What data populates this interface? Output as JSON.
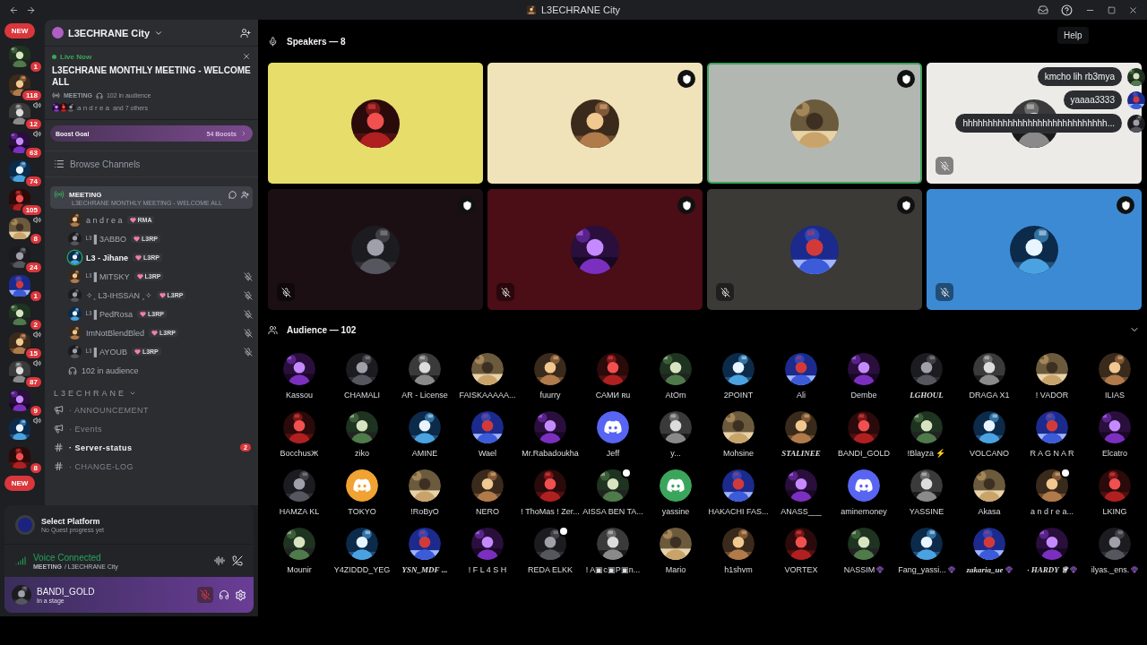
{
  "title_bar": {
    "title": "L3ECHRANE City",
    "tooltip": "Help"
  },
  "servers": [
    {
      "kind": "pill",
      "badge": "NEW"
    },
    {
      "kind": "server",
      "badge": "1",
      "in_voice": false
    },
    {
      "kind": "server",
      "badge": "118",
      "in_voice": false
    },
    {
      "kind": "server",
      "badge": "12",
      "in_voice": true
    },
    {
      "kind": "server",
      "badge": "63",
      "in_voice": true
    },
    {
      "kind": "server",
      "badge": "74",
      "in_voice": false
    },
    {
      "kind": "server",
      "badge": "105",
      "in_voice": false
    },
    {
      "kind": "server",
      "badge": "8",
      "in_voice": true
    },
    {
      "kind": "server",
      "badge": "24",
      "in_voice": false
    },
    {
      "kind": "server",
      "badge": "1",
      "in_voice": false
    },
    {
      "kind": "server",
      "badge": "2",
      "in_voice": false
    },
    {
      "kind": "server",
      "badge": "15",
      "in_voice": true
    },
    {
      "kind": "server",
      "badge": "87",
      "in_voice": true
    },
    {
      "kind": "server",
      "badge": "9",
      "in_voice": false
    },
    {
      "kind": "server",
      "in_voice": true
    },
    {
      "kind": "server",
      "badge": "8",
      "in_voice": false
    },
    {
      "kind": "pill",
      "badge": "NEW"
    }
  ],
  "server": {
    "name": "L3ECHRANE City"
  },
  "event": {
    "status": "Live Now",
    "title": "L3ECHRANE MONTHLY MEETING - WELCOME ALL",
    "channel": "MEETING",
    "audience": "102 in audience",
    "host": "a n d r e a",
    "others": "and 7 others"
  },
  "boost": {
    "label": "Boost Goal",
    "count": "54 Boosts"
  },
  "browse": "Browse Channels",
  "stage_channel": {
    "name": "MEETING",
    "topic": "L3ECHRANE MONTHLY MEETING - WELCOME ALL",
    "selected": true
  },
  "members": [
    {
      "name": "a n d r e a",
      "tag": "RMA",
      "muted": false,
      "speaking": false
    },
    {
      "name": "ᴸ³ ▌3ABBO",
      "tag": "L3RP",
      "muted": false,
      "speaking": false
    },
    {
      "name": "L3 - Jihane",
      "tag": "L3RP",
      "muted": false,
      "speaking": true
    },
    {
      "name": "ᴸ³ ▌MITSKY",
      "tag": "L3RP",
      "muted": true,
      "speaking": false
    },
    {
      "name": "✧˳ L3-IHSSAN ˳✧",
      "tag": "L3RP",
      "muted": true,
      "speaking": false
    },
    {
      "name": "ᴸ³ ▌PedRosa",
      "tag": "L3RP",
      "muted": true,
      "speaking": false
    },
    {
      "name": "ImNotBlendBled",
      "tag": "L3RP",
      "muted": true,
      "speaking": false
    },
    {
      "name": "ᴸ³ ▌AYOUB",
      "tag": "L3RP",
      "muted": true,
      "speaking": false
    }
  ],
  "audience_count": "102 in audience",
  "category": {
    "name": "L3ECHRANE",
    "expanded": true
  },
  "channels": [
    {
      "name": "· ANNOUNCEMENT",
      "kind": "announcement",
      "unread": false
    },
    {
      "name": "· Events",
      "kind": "announcement",
      "unread": false
    },
    {
      "name": "· Server-status",
      "kind": "text",
      "unread": true,
      "mentions": "2"
    },
    {
      "name": "· CHANGE-LOG",
      "kind": "text",
      "unread": false
    }
  ],
  "quest": {
    "title": "Select Platform",
    "subtitle": "No Quest progress yet"
  },
  "voice": {
    "status": "Voice Connected",
    "channel": "MEETING",
    "server": "/ L3ECHRANE City"
  },
  "user": {
    "name": "BANDI_GOLD",
    "status": "In a stage",
    "mic_muted": true
  },
  "speakers_header": "Speakers — 8",
  "speakers": [
    {
      "color": "#e6dd6a",
      "moderator": false,
      "muted": false,
      "speaking": false
    },
    {
      "color": "#f0e3b9",
      "moderator": true,
      "muted": false,
      "speaking": false
    },
    {
      "color": "#b3b7b1",
      "moderator": true,
      "muted": false,
      "speaking": true
    },
    {
      "color": "#edebe8",
      "moderator": false,
      "muted": true,
      "speaking": false
    },
    {
      "color": "#1c0f14",
      "moderator": true,
      "muted": true,
      "speaking": false
    },
    {
      "color": "#4b0d16",
      "moderator": true,
      "muted": true,
      "speaking": false
    },
    {
      "color": "#3b3a37",
      "moderator": true,
      "muted": true,
      "speaking": false
    },
    {
      "color": "#3d8ad4",
      "moderator": true,
      "muted": true,
      "speaking": false
    }
  ],
  "bubbles": [
    {
      "text": "kmcho lih rb3mya"
    },
    {
      "text": "yaaaa3333"
    },
    {
      "text": "hhhhhhhhhhhhhhhhhhhhhhhhhhhhh..."
    }
  ],
  "audience_header": "Audience — 102",
  "audience": [
    {
      "name": "Kassou",
      "fancy": false,
      "boosted": false,
      "badge": false
    },
    {
      "name": "CHAMALI",
      "fancy": false,
      "boosted": false,
      "badge": false
    },
    {
      "name": "AR - License",
      "fancy": false,
      "boosted": false,
      "badge": false
    },
    {
      "name": "FAISKAAAAA...",
      "fancy": false,
      "boosted": false,
      "badge": false
    },
    {
      "name": "fuurry",
      "fancy": false,
      "boosted": false,
      "badge": false
    },
    {
      "name": "САМИ ʀu",
      "fancy": false,
      "boosted": false,
      "badge": false
    },
    {
      "name": "AtOm",
      "fancy": false,
      "boosted": false,
      "badge": false
    },
    {
      "name": "2POINT",
      "fancy": false,
      "boosted": false,
      "badge": false
    },
    {
      "name": "Ali",
      "fancy": false,
      "boosted": false,
      "badge": false
    },
    {
      "name": "Dembe",
      "fancy": false,
      "boosted": false,
      "badge": false
    },
    {
      "name": "LGHOUL",
      "fancy": true,
      "boosted": false,
      "badge": false
    },
    {
      "name": "DRAGA X1",
      "fancy": false,
      "boosted": false,
      "badge": false
    },
    {
      "name": "! VADOR",
      "fancy": false,
      "boosted": false,
      "badge": false
    },
    {
      "name": "ILIAS",
      "fancy": false,
      "boosted": false,
      "badge": false
    },
    {
      "name": "BocchusЖ",
      "fancy": false,
      "boosted": false,
      "badge": false
    },
    {
      "name": "ziko",
      "fancy": false,
      "boosted": false,
      "badge": false
    },
    {
      "name": "AMINE",
      "fancy": false,
      "boosted": false,
      "badge": false
    },
    {
      "name": "Wael",
      "fancy": false,
      "boosted": false,
      "badge": false
    },
    {
      "name": "Mr.Rabadoukha",
      "fancy": false,
      "boosted": false,
      "badge": false
    },
    {
      "name": "Jeff",
      "kind": "default",
      "color": "#5865f2",
      "fancy": false,
      "boosted": false,
      "badge": false
    },
    {
      "name": "y...",
      "fancy": false,
      "boosted": false,
      "badge": false
    },
    {
      "name": "Mohsine",
      "fancy": false,
      "boosted": false,
      "badge": false
    },
    {
      "name": "STALINEE",
      "fancy": true,
      "boosted": false,
      "badge": false
    },
    {
      "name": "BANDI_GOLD",
      "fancy": false,
      "boosted": false,
      "badge": false
    },
    {
      "name": "!Blayza ⚡",
      "fancy": false,
      "boosted": false,
      "badge": false
    },
    {
      "name": "VOLCANO",
      "fancy": false,
      "boosted": false,
      "badge": false
    },
    {
      "name": "R A G N A R",
      "fancy": false,
      "boosted": false,
      "badge": false
    },
    {
      "name": "Elcatro",
      "fancy": false,
      "boosted": false,
      "badge": false
    },
    {
      "name": "HAMZA KL",
      "fancy": false,
      "boosted": false,
      "badge": false
    },
    {
      "name": "TOKYO",
      "kind": "default",
      "color": "#f0a232",
      "fancy": false,
      "boosted": false,
      "badge": false
    },
    {
      "name": "!RoByO",
      "fancy": false,
      "boosted": false,
      "badge": false
    },
    {
      "name": "NERO",
      "fancy": false,
      "boosted": false,
      "badge": false
    },
    {
      "name": "! ThoMas ! Zer...",
      "fancy": false,
      "boosted": false,
      "badge": false
    },
    {
      "name": "AISSA BEN TA...",
      "fancy": false,
      "boosted": false,
      "badge": true
    },
    {
      "name": "yassine",
      "kind": "default",
      "color": "#3ba55c",
      "fancy": false,
      "boosted": false,
      "badge": false
    },
    {
      "name": "HAKACHI FAS...",
      "fancy": false,
      "boosted": false,
      "badge": false
    },
    {
      "name": "ANASS___",
      "fancy": false,
      "boosted": false,
      "badge": false
    },
    {
      "name": "aminemoney",
      "kind": "default",
      "color": "#5865f2",
      "fancy": false,
      "boosted": false,
      "badge": false
    },
    {
      "name": "YASSINE",
      "fancy": false,
      "boosted": false,
      "badge": false
    },
    {
      "name": "Akasa",
      "fancy": false,
      "boosted": false,
      "badge": false
    },
    {
      "name": "a n d r e a...",
      "fancy": false,
      "boosted": false,
      "badge": true
    },
    {
      "name": "LKING",
      "fancy": false,
      "boosted": false,
      "badge": false
    },
    {
      "name": "Mounir",
      "fancy": false,
      "boosted": false,
      "badge": false
    },
    {
      "name": "Y4ZIDDD_YEG",
      "fancy": false,
      "boosted": false,
      "badge": false
    },
    {
      "name": "YSN_MDF ...",
      "fancy": true,
      "boosted": false,
      "badge": false
    },
    {
      "name": "! F L 4 S H",
      "fancy": false,
      "boosted": false,
      "badge": false
    },
    {
      "name": "REDA ELKK",
      "fancy": false,
      "boosted": false,
      "badge": true
    },
    {
      "name": "! A▣c▣P▣n...",
      "fancy": false,
      "boosted": false,
      "badge": false
    },
    {
      "name": "Mario",
      "fancy": false,
      "boosted": false,
      "badge": false
    },
    {
      "name": "h1shvm",
      "fancy": false,
      "boosted": false,
      "badge": false
    },
    {
      "name": "VORTEX",
      "fancy": false,
      "boosted": false,
      "badge": false
    },
    {
      "name": "NASSIM",
      "fancy": false,
      "boosted": true,
      "badge": false
    },
    {
      "name": "Fang_yassi...",
      "fancy": false,
      "boosted": true,
      "badge": false
    },
    {
      "name": "zakaria_ue",
      "fancy": true,
      "boosted": true,
      "badge": false
    },
    {
      "name": "· HARDY ♕",
      "fancy": true,
      "boosted": true,
      "badge": false
    },
    {
      "name": "ilyas._ens.",
      "fancy": false,
      "boosted": true,
      "badge": false
    }
  ]
}
